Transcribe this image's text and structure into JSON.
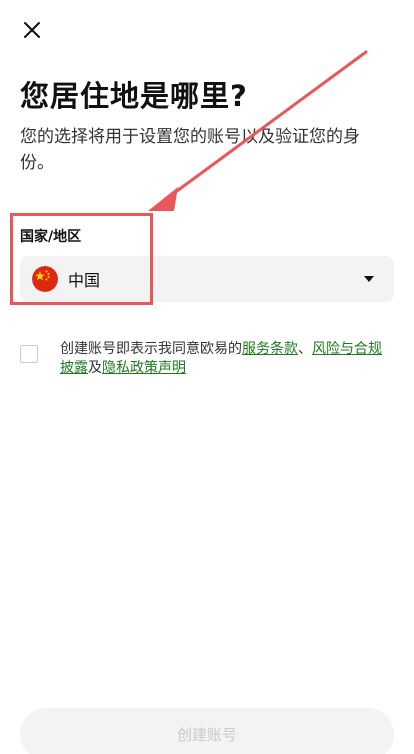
{
  "header": {
    "close_icon": "close-icon"
  },
  "main": {
    "title": "您居住地是哪里?",
    "subtitle": "您的选择将用于设置您的账号以及验证您的身份。"
  },
  "country_field": {
    "label": "国家/地区",
    "value": "中国",
    "flag_icon": "china-flag-icon",
    "dropdown_icon": "caret-down-icon"
  },
  "agreement": {
    "prefix": "创建账号即表示我同意欧易的",
    "link_terms": "服务条款",
    "sep1": "、",
    "link_risk": "风险与合规披露",
    "sep2": "及",
    "link_privacy": "隐私政策声明"
  },
  "footer": {
    "create_button_label": "创建账号"
  },
  "colors": {
    "link": "#1f7a1f",
    "annotation_red": "#e8585b",
    "button_bg_disabled": "#f3f3f3",
    "button_text_disabled": "#c9c9c9"
  }
}
